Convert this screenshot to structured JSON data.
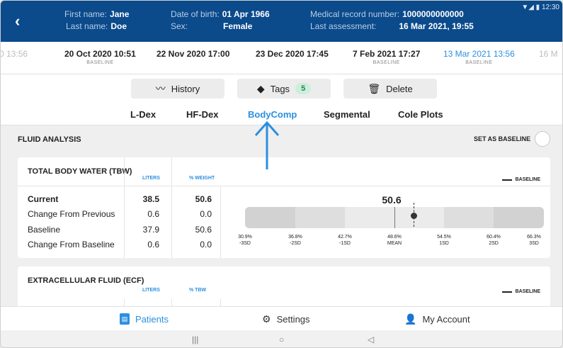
{
  "header": {
    "first_name_label": "First name:",
    "first_name": "Jane",
    "last_name_label": "Last name:",
    "last_name": "Doe",
    "dob_label": "Date of birth:",
    "dob": "01 Apr 1966",
    "sex_label": "Sex:",
    "sex": "Female",
    "mrn_label": "Medical record number:",
    "mrn": "1000000000000",
    "last_assessment_label": "Last assessment:",
    "last_assessment": "16 Mar 2021, 19:55",
    "status_time": "12:30",
    "status_icons": "▼◢ ▮"
  },
  "dates": [
    {
      "date": "0 13:56",
      "baseline": ""
    },
    {
      "date": "20 Oct 2020 10:51",
      "baseline": "BASELINE"
    },
    {
      "date": "22 Nov 2020 17:00",
      "baseline": ""
    },
    {
      "date": "23 Dec 2020 17:45",
      "baseline": ""
    },
    {
      "date": "7 Feb 2021 17:27",
      "baseline": "BASELINE"
    },
    {
      "date": "13 Mar 2021 13:56",
      "baseline": "BASELINE"
    },
    {
      "date": "16 M",
      "baseline": ""
    }
  ],
  "actions": {
    "history": "History",
    "tags": "Tags",
    "tags_count": "5",
    "delete": "Delete"
  },
  "tabs": [
    "L-Dex",
    "HF-Dex",
    "BodyComp",
    "Segmental",
    "Cole Plots"
  ],
  "active_tab": "BodyComp",
  "fluid": {
    "title": "FLUID ANALYSIS",
    "set_baseline": "SET AS BASELINE"
  },
  "tbw": {
    "title": "TOTAL BODY WATER (TBW)",
    "col1": "LITERS",
    "col2": "% WEIGHT",
    "baseline_key": "BASELINE",
    "rows": [
      {
        "label": "Current",
        "v1": "38.5",
        "v2": "50.6",
        "bold": true
      },
      {
        "label": "Change From Previous",
        "v1": "0.6",
        "v2": "0.0",
        "bold": false
      },
      {
        "label": "Baseline",
        "v1": "37.9",
        "v2": "50.6",
        "bold": false
      },
      {
        "label": "Change From Baseline",
        "v1": "0.6",
        "v2": "0.0",
        "bold": false
      }
    ],
    "gauge_value": "50.6",
    "gauge_ticks": [
      {
        "pct": "30.9%",
        "sd": "-3SD"
      },
      {
        "pct": "36.8%",
        "sd": "-2SD"
      },
      {
        "pct": "42.7%",
        "sd": "-1SD"
      },
      {
        "pct": "48.6%",
        "sd": "MEAN"
      },
      {
        "pct": "54.5%",
        "sd": "1SD"
      },
      {
        "pct": "60.4%",
        "sd": "2SD"
      },
      {
        "pct": "66.3%",
        "sd": "3SD"
      }
    ]
  },
  "ecf": {
    "title": "EXTRACELLULAR FLUID (ECF)",
    "col1": "LITERS",
    "col2": "% TBW",
    "baseline_key": "BASELINE"
  },
  "bottom_nav": {
    "patients": "Patients",
    "settings": "Settings",
    "account": "My Account"
  },
  "system_nav": {
    "recents": "|||",
    "home": "○",
    "back": "◁"
  },
  "colors": {
    "header_bg": "#0b4a8b",
    "accent": "#2b8fe0",
    "tag_badge": "#cdeedd"
  }
}
